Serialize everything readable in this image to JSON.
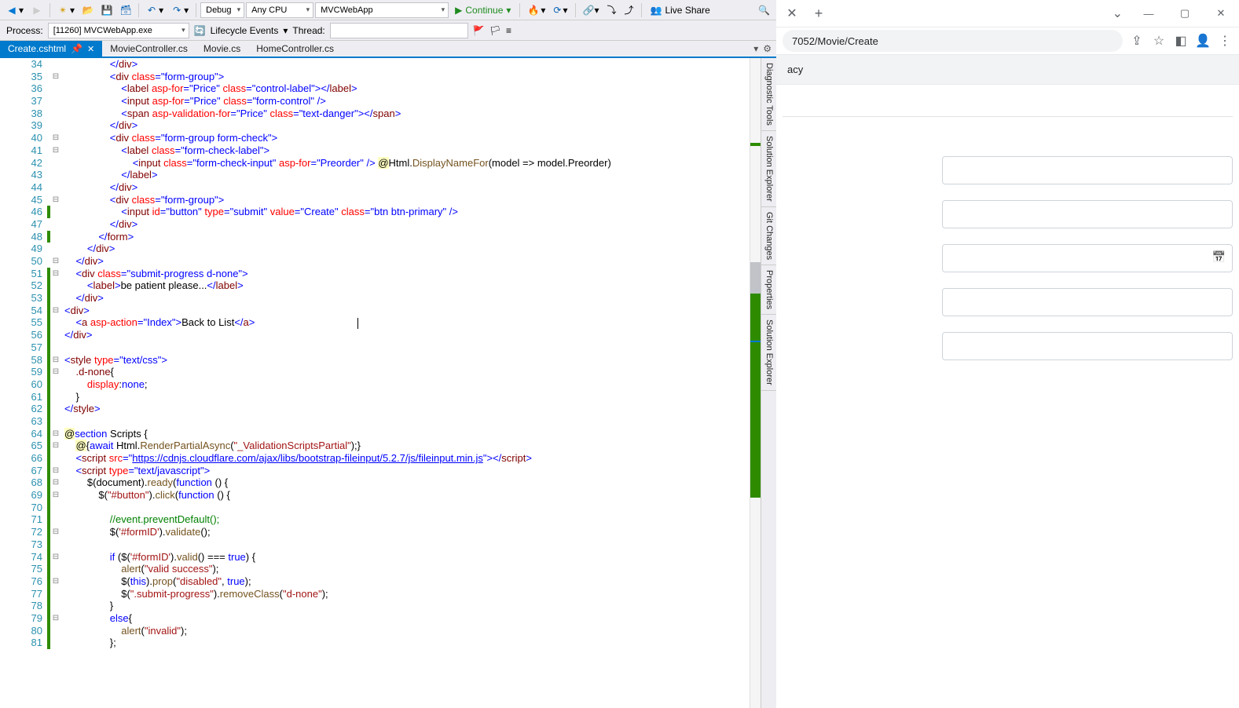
{
  "vs": {
    "toolbar": {
      "config": "Debug",
      "platform": "Any CPU",
      "project": "MVCWebApp",
      "continue": "Continue",
      "liveshare": "Live Share"
    },
    "toolbar2": {
      "process_label": "Process:",
      "process_value": "[11260] MVCWebApp.exe",
      "lifecycle": "Lifecycle Events",
      "thread_label": "Thread:"
    },
    "tabs": [
      {
        "label": "Create.cshtml",
        "active": true
      },
      {
        "label": "MovieController.cs",
        "active": false
      },
      {
        "label": "Movie.cs",
        "active": false
      },
      {
        "label": "HomeController.cs",
        "active": false
      }
    ],
    "right_panels": [
      "Diagnostic Tools",
      "Solution Explorer",
      "Git Changes",
      "Properties",
      "Solution Explorer"
    ],
    "first_line": 34,
    "last_line": 81,
    "change_green_lines": [
      46,
      48,
      51,
      52,
      53,
      54,
      55,
      56,
      57,
      58,
      59,
      60,
      61,
      62,
      63,
      64,
      65,
      66,
      67,
      68,
      69,
      70,
      71,
      72,
      73,
      74,
      75,
      76,
      77,
      78,
      79,
      80,
      81
    ],
    "code": {
      "34": {
        "indent": 16,
        "html": "<span class=t-punc>&lt;/</span><span class=t-tag>div</span><span class=t-punc>&gt;</span>"
      },
      "35": {
        "indent": 16,
        "html": "<span class=t-punc>&lt;</span><span class=t-tag>div</span> <span class=t-attr>class</span><span class=t-punc>=</span><span class=t-val>\"form-group\"</span><span class=t-punc>&gt;</span>"
      },
      "36": {
        "indent": 20,
        "html": "<span class=t-punc>&lt;</span><span class=t-tag>label</span> <span class=t-attr>asp-for</span><span class=t-punc>=</span><span class=t-val>\"Price\"</span> <span class=t-attr>class</span><span class=t-punc>=</span><span class=t-val>\"control-label\"</span><span class=t-punc>&gt;&lt;/</span><span class=t-tag>label</span><span class=t-punc>&gt;</span>"
      },
      "37": {
        "indent": 20,
        "html": "<span class=t-punc>&lt;</span><span class=t-tag>input</span> <span class=t-attr>asp-for</span><span class=t-punc>=</span><span class=t-val>\"Price\"</span> <span class=t-attr>class</span><span class=t-punc>=</span><span class=t-val>\"form-control\"</span> <span class=t-punc>/&gt;</span>"
      },
      "38": {
        "indent": 20,
        "html": "<span class=t-punc>&lt;</span><span class=t-tag>span</span> <span class=t-attr>asp-validation-for</span><span class=t-punc>=</span><span class=t-val>\"Price\"</span> <span class=t-attr>class</span><span class=t-punc>=</span><span class=t-val>\"text-danger\"</span><span class=t-punc>&gt;&lt;/</span><span class=t-tag>span</span><span class=t-punc>&gt;</span>"
      },
      "39": {
        "indent": 16,
        "html": "<span class=t-punc>&lt;/</span><span class=t-tag>div</span><span class=t-punc>&gt;</span>"
      },
      "40": {
        "indent": 16,
        "html": "<span class=t-punc>&lt;</span><span class=t-tag>div</span> <span class=t-attr>class</span><span class=t-punc>=</span><span class=t-val>\"form-group form-check\"</span><span class=t-punc>&gt;</span>"
      },
      "41": {
        "indent": 20,
        "html": "<span class=t-punc>&lt;</span><span class=t-tag>label</span> <span class=t-attr>class</span><span class=t-punc>=</span><span class=t-val>\"form-check-label\"</span><span class=t-punc>&gt;</span>"
      },
      "42": {
        "indent": 24,
        "html": "<span class=t-punc>&lt;</span><span class=t-tag>input</span> <span class=t-attr>class</span><span class=t-punc>=</span><span class=t-val>\"form-check-input\"</span> <span class=t-attr>asp-for</span><span class=t-punc>=</span><span class=t-val>\"Preorder\"</span> <span class=t-punc>/&gt;</span> <span class=t-bg-y>@</span>Html.<span class=t-meth>DisplayNameFor</span>(model =&gt; model.Preorder)"
      },
      "43": {
        "indent": 20,
        "html": "<span class=t-punc>&lt;/</span><span class=t-tag>label</span><span class=t-punc>&gt;</span>"
      },
      "44": {
        "indent": 16,
        "html": "<span class=t-punc>&lt;/</span><span class=t-tag>div</span><span class=t-punc>&gt;</span>"
      },
      "45": {
        "indent": 16,
        "html": "<span class=t-punc>&lt;</span><span class=t-tag>div</span> <span class=t-attr>class</span><span class=t-punc>=</span><span class=t-val>\"form-group\"</span><span class=t-punc>&gt;</span>"
      },
      "46": {
        "indent": 20,
        "html": "<span class=t-punc>&lt;</span><span class=t-tag>input</span> <span class=t-attr>id</span><span class=t-punc>=</span><span class=t-val>\"button\"</span> <span class=t-attr>type</span><span class=t-punc>=</span><span class=t-val>\"submit\"</span> <span class=t-attr>value</span><span class=t-punc>=</span><span class=t-val>\"Create\"</span> <span class=t-attr>class</span><span class=t-punc>=</span><span class=t-val>\"btn btn-primary\"</span> <span class=t-punc>/&gt;</span>"
      },
      "47": {
        "indent": 16,
        "html": "<span class=t-punc>&lt;/</span><span class=t-tag>div</span><span class=t-punc>&gt;</span>"
      },
      "48": {
        "indent": 12,
        "html": "<span class=t-punc>&lt;/</span><span class=t-tag>form</span><span class=t-punc>&gt;</span>"
      },
      "49": {
        "indent": 8,
        "html": "<span class=t-punc>&lt;/</span><span class=t-tag>div</span><span class=t-punc>&gt;</span>"
      },
      "50": {
        "indent": 4,
        "html": "<span class=t-punc>&lt;/</span><span class=t-tag>div</span><span class=t-punc>&gt;</span>"
      },
      "51": {
        "indent": 4,
        "html": "<span class=t-punc>&lt;</span><span class=t-tag>div</span> <span class=t-attr>class</span><span class=t-punc>=</span><span class=t-val>\"submit-progress d-none\"</span><span class=t-punc>&gt;</span>"
      },
      "52": {
        "indent": 8,
        "html": "<span class=t-punc>&lt;</span><span class=t-tag>label</span><span class=t-punc>&gt;</span>be patient please...<span class=t-punc>&lt;/</span><span class=t-tag>label</span><span class=t-punc>&gt;</span>"
      },
      "53": {
        "indent": 4,
        "html": "<span class=t-punc>&lt;/</span><span class=t-tag>div</span><span class=t-punc>&gt;</span>"
      },
      "54": {
        "indent": 0,
        "html": "<span class=t-punc>&lt;</span><span class=t-tag>div</span><span class=t-punc>&gt;</span>"
      },
      "55": {
        "indent": 4,
        "html": "<span class=t-punc>&lt;</span><span class=t-tag>a</span> <span class=t-attr>asp-action</span><span class=t-punc>=</span><span class=t-val>\"Index\"</span><span class=t-punc>&gt;</span>Back to List<span class=t-punc>&lt;/</span><span class=t-tag>a</span><span class=t-punc>&gt;</span>                                    <span class=caret></span>"
      },
      "56": {
        "indent": 0,
        "html": "<span class=t-punc>&lt;/</span><span class=t-tag>div</span><span class=t-punc>&gt;</span>"
      },
      "57": {
        "indent": 0,
        "html": ""
      },
      "58": {
        "indent": 0,
        "html": "<span class=t-punc>&lt;</span><span class=t-tag>style</span> <span class=t-attr>type</span><span class=t-punc>=</span><span class=t-val>\"text/css\"</span><span class=t-punc>&gt;</span>"
      },
      "59": {
        "indent": 4,
        "html": "<span class=t-tag>.d-none</span>{"
      },
      "60": {
        "indent": 8,
        "html": "<span class=t-css-prop>display</span>:<span class=t-css-val>none</span>;"
      },
      "61": {
        "indent": 4,
        "html": "}"
      },
      "62": {
        "indent": 0,
        "html": "<span class=t-punc>&lt;/</span><span class=t-tag>style</span><span class=t-punc>&gt;</span>"
      },
      "63": {
        "indent": 0,
        "html": ""
      },
      "64": {
        "indent": 0,
        "html": "<span class=t-bg-y>@</span><span class=t-kw>section</span> Scripts {"
      },
      "65": {
        "indent": 4,
        "html": "<span class=t-bg-y>@</span>{<span class=t-kw>await</span> Html.<span class=t-meth>RenderPartialAsync</span>(<span class=t-str>\"_ValidationScriptsPartial\"</span>);}"
      },
      "66": {
        "indent": 4,
        "html": "<span class=t-punc>&lt;</span><span class=t-tag>script</span> <span class=t-attr>src</span><span class=t-punc>=</span><span class=t-val>\"</span><span class=t-url>https://cdnjs.cloudflare.com/ajax/libs/bootstrap-fileinput/5.2.7/js/fileinput.min.js</span><span class=t-val>\"</span><span class=t-punc>&gt;&lt;/</span><span class=t-tag>script</span><span class=t-punc>&gt;</span>"
      },
      "67": {
        "indent": 4,
        "html": "<span class=t-punc>&lt;</span><span class=t-tag>script</span> <span class=t-attr>type</span><span class=t-punc>=</span><span class=t-val>\"text/javascript\"</span><span class=t-punc>&gt;</span>"
      },
      "68": {
        "indent": 8,
        "html": "$(document).<span class=t-meth>ready</span>(<span class=t-kw>function</span> () {"
      },
      "69": {
        "indent": 12,
        "html": "$(<span class=t-str>\"#button\"</span>).<span class=t-meth>click</span>(<span class=t-kw>function</span> () {"
      },
      "70": {
        "indent": 0,
        "html": ""
      },
      "71": {
        "indent": 16,
        "html": "<span class=t-cmt>//event.preventDefault();</span>"
      },
      "72": {
        "indent": 16,
        "html": "$(<span class=t-str>'#formID'</span>).<span class=t-meth>validate</span>();"
      },
      "73": {
        "indent": 0,
        "html": ""
      },
      "74": {
        "indent": 16,
        "html": "<span class=t-kw>if</span> ($(<span class=t-str>'#formID'</span>).<span class=t-meth>valid</span>() === <span class=t-kw>true</span>) {"
      },
      "75": {
        "indent": 20,
        "html": "<span class=t-meth>alert</span>(<span class=t-str>\"valid success\"</span>);"
      },
      "76": {
        "indent": 20,
        "html": "$(<span class=t-kw>this</span>).<span class=t-meth>prop</span>(<span class=t-str>\"disabled\"</span>, <span class=t-kw>true</span>);"
      },
      "77": {
        "indent": 20,
        "html": "$(<span class=t-str>\".submit-progress\"</span>).<span class=t-meth>removeClass</span>(<span class=t-str>\"d-none\"</span>);"
      },
      "78": {
        "indent": 16,
        "html": "}"
      },
      "79": {
        "indent": 16,
        "html": "<span class=t-kw>else</span>{"
      },
      "80": {
        "indent": 20,
        "html": "<span class=t-meth>alert</span>(<span class=t-str>\"invalid\"</span>);"
      },
      "81": {
        "indent": 16,
        "html": "};"
      }
    }
  },
  "browser": {
    "url_visible": "7052/Movie/Create",
    "infobar": "acy",
    "window": {
      "min": "—",
      "max": "▢",
      "close": "✕"
    }
  }
}
